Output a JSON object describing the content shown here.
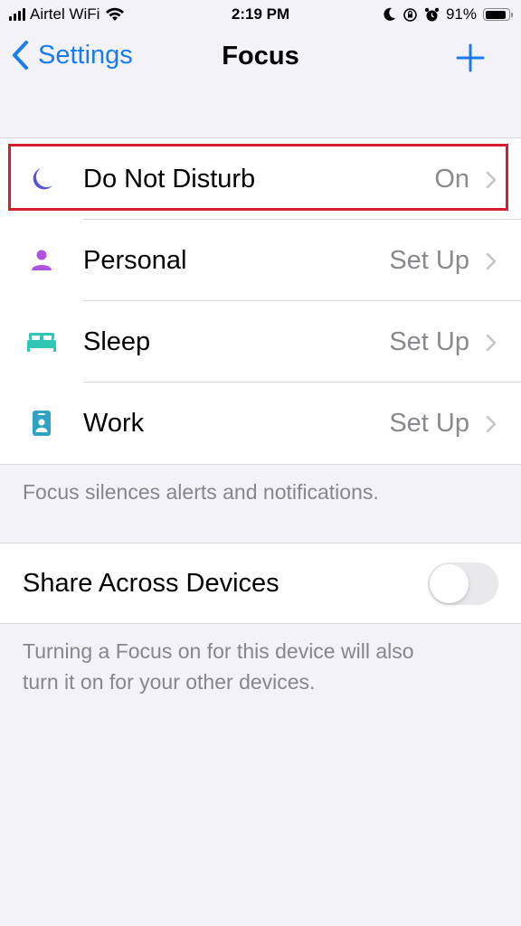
{
  "status_bar": {
    "carrier": "Airtel WiFi",
    "time": "2:19 PM",
    "battery": "91%",
    "battery_level": 0.91,
    "icons": [
      "signal-icon",
      "wifi-icon",
      "moon-icon",
      "orientation-lock-icon",
      "alarm-icon",
      "battery-icon"
    ]
  },
  "nav": {
    "back_label": "Settings",
    "title": "Focus",
    "add_icon": "plus-icon"
  },
  "focus_modes": [
    {
      "label": "Do Not Disturb",
      "value": "On",
      "icon": "moon-icon",
      "color": "#5856d6"
    },
    {
      "label": "Personal",
      "value": "Set Up",
      "icon": "person-icon",
      "color": "#af52de"
    },
    {
      "label": "Sleep",
      "value": "Set Up",
      "icon": "bed-icon",
      "color": "#30c7b5"
    },
    {
      "label": "Work",
      "value": "Set Up",
      "icon": "id-badge-icon",
      "color": "#30a3c4"
    }
  ],
  "focus_footer": "Focus silences alerts and notifications.",
  "share": {
    "label": "Share Across Devices",
    "enabled": false,
    "footer_line1": "Turning a Focus on for this device will also",
    "footer_line2": "turn it on for your other devices."
  },
  "colors": {
    "accent": "#1a7cf0",
    "highlight_border": "#d3202c",
    "background": "#f2f2f7"
  }
}
